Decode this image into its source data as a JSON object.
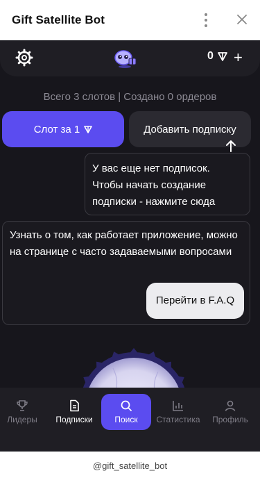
{
  "telegram": {
    "title": "Gift Satellite Bot",
    "menu_icon": "more-vertical-icon",
    "close_icon": "close-icon"
  },
  "topbar": {
    "settings_icon": "gear-icon",
    "logo_icon": "satellite-bot-logo-icon",
    "balance": "0",
    "currency_icon": "ton-icon",
    "add_icon": "plus-icon"
  },
  "summary": "Всего 3 слотов | Создано 0 ордеров",
  "buttons": {
    "slot_label": "Слот за 1",
    "add_subscription_label": "Добавить подписку",
    "faq_label": "Перейти в F.A.Q"
  },
  "tip": {
    "text": "У вас еще нет подписок. Чтобы начать создание подписки - нажмите сюда"
  },
  "faq_card": {
    "text": "Узнать о том, как работает приложение, можно на странице с часто задаваемыми вопросами"
  },
  "nav": {
    "items": [
      {
        "label": "Лидеры",
        "icon": "trophy-icon"
      },
      {
        "label": "Подписки",
        "icon": "document-icon"
      },
      {
        "label": "Поиск",
        "icon": "search-icon"
      },
      {
        "label": "Статистика",
        "icon": "bar-chart-icon"
      },
      {
        "label": "Профиль",
        "icon": "profile-icon"
      }
    ],
    "active_index": 2
  },
  "footer": "@gift_satellite_bot",
  "colors": {
    "accent": "#5b4cf0",
    "app_bg": "#17161c",
    "panel_bg": "#1f1e24"
  }
}
